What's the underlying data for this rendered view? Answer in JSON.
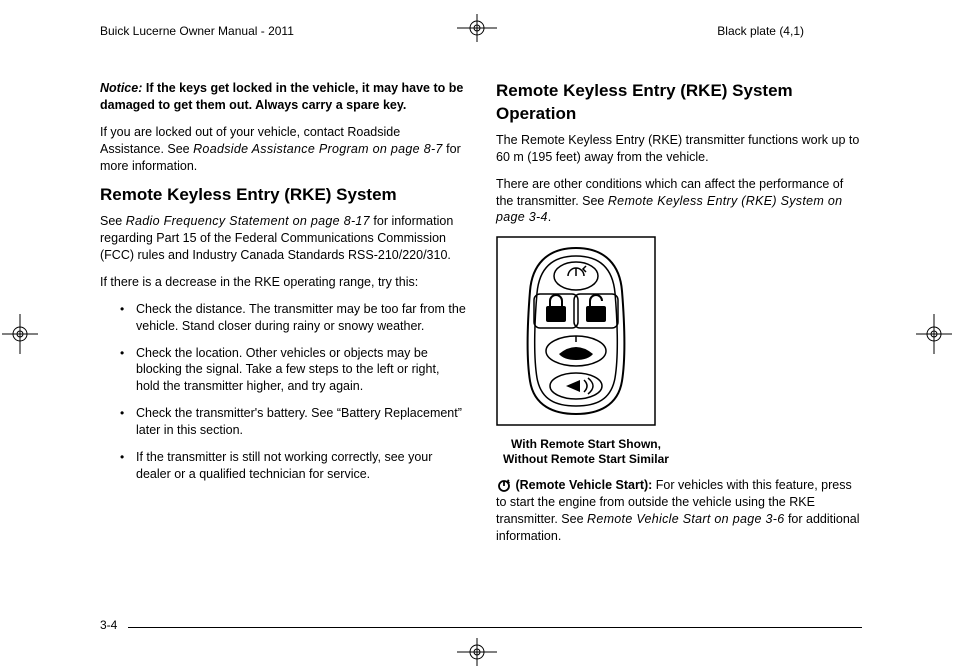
{
  "runhead": {
    "title": "Buick Lucerne Owner Manual - 2011",
    "plate": "Black plate (4,1)"
  },
  "left": {
    "notice_label": "Notice:",
    "notice_text": " If the keys get locked in the vehicle, it may have to be damaged to get them out. Always carry a spare key.",
    "locked_out_1": "If you are locked out of your vehicle, contact Roadside Assistance. See ",
    "locked_out_ref": "Roadside Assistance Program on page 8‑7",
    "locked_out_2": " for more information.",
    "h_rke": "Remote Keyless Entry (RKE) System",
    "rfs_1": "See ",
    "rfs_ref": "Radio Frequency Statement on page 8‑17",
    "rfs_2": " for information regarding Part 15 of the Federal Communications Commission (FCC) rules and Industry Canada Standards RSS-210/220/310.",
    "range_intro": "If there is a decrease in the RKE operating range, try this:",
    "bullets": [
      "Check the distance. The transmitter may be too far from the vehicle. Stand closer during rainy or snowy weather.",
      "Check the location. Other vehicles or objects may be blocking the signal. Take a few steps to the left or right, hold the transmitter higher, and try again.",
      "Check the transmitter's battery. See “Battery Replacement” later in this section.",
      "If the transmitter is still not working correctly, see your dealer or a qualified technician for service."
    ]
  },
  "right": {
    "h_op": "Remote Keyless Entry (RKE) System Operation",
    "op_p1": "The Remote Keyless Entry (RKE) transmitter functions work up to 60 m (195 feet) away from the vehicle.",
    "op_p2_a": "There are other conditions which can affect the performance of the transmitter. See ",
    "op_p2_ref": "Remote Keyless Entry (RKE) System on page 3‑4",
    "op_p2_b": ".",
    "caption": "With Remote Start Shown, Without Remote Start Similar",
    "rvs_label": " (Remote Vehicle Start):",
    "rvs_text_a": " For vehicles with this feature, press to start the engine from outside the vehicle using the RKE transmitter. See ",
    "rvs_ref": "Remote Vehicle Start on page 3‑6",
    "rvs_text_b": " for additional information."
  },
  "pagenum": "3-4"
}
